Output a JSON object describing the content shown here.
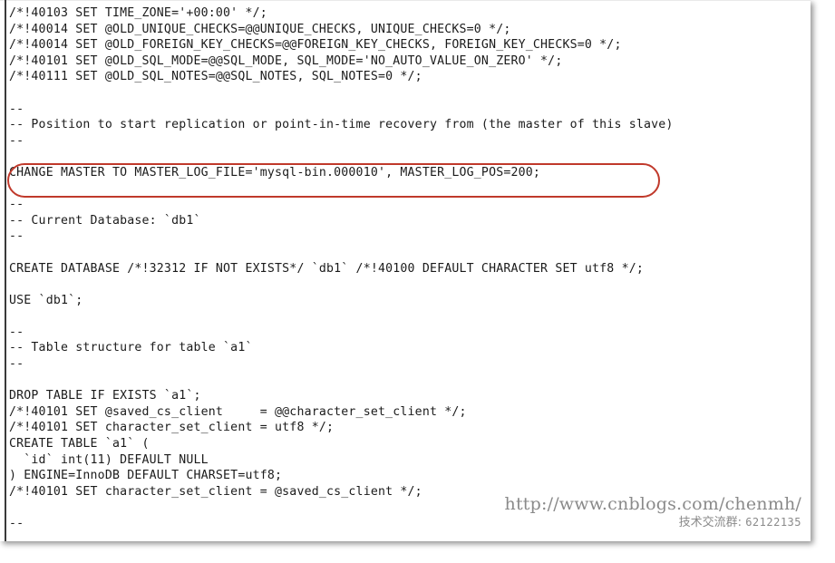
{
  "document": {
    "kind": "mysqldump-sql-output",
    "lines": [
      "/*!40103 SET TIME_ZONE='+00:00' */;",
      "/*!40014 SET @OLD_UNIQUE_CHECKS=@@UNIQUE_CHECKS, UNIQUE_CHECKS=0 */;",
      "/*!40014 SET @OLD_FOREIGN_KEY_CHECKS=@@FOREIGN_KEY_CHECKS, FOREIGN_KEY_CHECKS=0 */;",
      "/*!40101 SET @OLD_SQL_MODE=@@SQL_MODE, SQL_MODE='NO_AUTO_VALUE_ON_ZERO' */;",
      "/*!40111 SET @OLD_SQL_NOTES=@@SQL_NOTES, SQL_NOTES=0 */;",
      "",
      "--",
      "-- Position to start replication or point-in-time recovery from (the master of this slave)",
      "--",
      "",
      "CHANGE MASTER TO MASTER_LOG_FILE='mysql-bin.000010', MASTER_LOG_POS=200;",
      "",
      "--",
      "-- Current Database: `db1`",
      "--",
      "",
      "CREATE DATABASE /*!32312 IF NOT EXISTS*/ `db1` /*!40100 DEFAULT CHARACTER SET utf8 */;",
      "",
      "USE `db1`;",
      "",
      "--",
      "-- Table structure for table `a1`",
      "--",
      "",
      "DROP TABLE IF EXISTS `a1`;",
      "/*!40101 SET @saved_cs_client     = @@character_set_client */;",
      "/*!40101 SET character_set_client = utf8 */;",
      "CREATE TABLE `a1` (",
      "  `id` int(11) DEFAULT NULL",
      ") ENGINE=InnoDB DEFAULT CHARSET=utf8;",
      "/*!40101 SET character_set_client = @saved_cs_client */;",
      "",
      "--"
    ]
  },
  "annotation": {
    "shape": "rounded-rectangle",
    "color": "#c0392b",
    "target_line_index": 10,
    "target_text": "CHANGE MASTER TO MASTER_LOG_FILE='mysql-bin.000010', MASTER_LOG_POS=200;"
  },
  "watermark": {
    "url": "http://www.cnblogs.com/chenmh/",
    "contact_label": "技术交流群:",
    "contact_number": "62122135",
    "color": "#8a8a8a"
  }
}
